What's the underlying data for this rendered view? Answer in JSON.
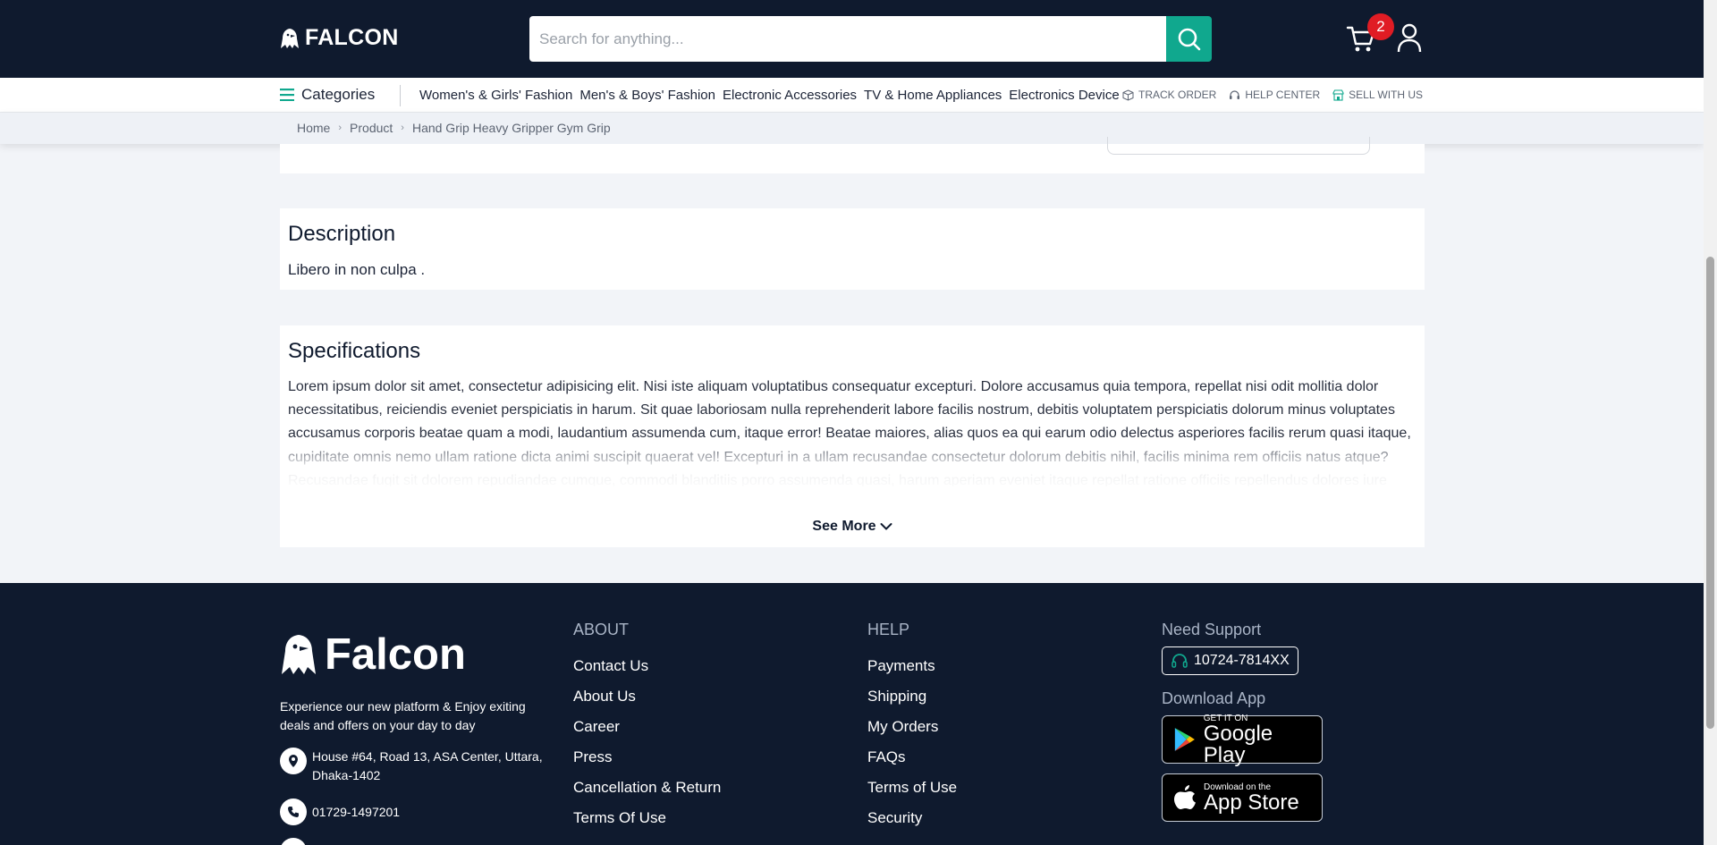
{
  "header": {
    "brand": "FALCON",
    "search_placeholder": "Search for anything...",
    "cart_count": "2",
    "accent_color": "#10a88e"
  },
  "nav": {
    "categories_label": "Categories",
    "links": [
      "Women's & Girls' Fashion",
      "Men's & Boys' Fashion",
      "Electronic Accessories",
      "TV & Home Appliances",
      "Electronics Device"
    ],
    "quick": [
      "TRACK ORDER",
      "HELP CENTER",
      "SELL WITH US"
    ]
  },
  "breadcrumb": [
    "Home",
    "Product",
    "Hand Grip Heavy Gripper Gym Grip"
  ],
  "description": {
    "title": "Description",
    "text": "Libero in non culpa ."
  },
  "specifications": {
    "title": "Specifications",
    "text": "Lorem ipsum dolor sit amet, consectetur adipisicing elit. Nisi iste aliquam voluptatibus consequatur excepturi. Dolore accusamus quia tempora, repellat nisi odit mollitia dolor necessitatibus, reiciendis eveniet perspiciatis in harum. Sit quae laboriosam nulla reprehenderit labore facilis nostrum, debitis voluptatem perspiciatis dolorum minus voluptates accusamus corporis beatae quam a modi, laudantium assumenda cum, itaque error! Beatae maiores, alias quos ea qui earum odio delectus asperiores facilis rerum quasi itaque, cupiditate omnis nemo ullam ratione dicta animi suscipit quaerat vel! Excepturi in a ullam recusandae consectetur dolorum debitis nihil, facilis minima rem officiis natus atque? Recusandae fugit sit dolorem repudiandae cumque, commodi blanditiis porro assumenda quasi, harum aperiam eveniet itaque repellat ratione officiis repellendus dolores iure expedita unde maiores autem minus? Corporis placeat, quo asperiores consequatur vitae inventore libero facere animi qui, tenetur",
    "see_more": "See More"
  },
  "footer": {
    "brand": "Falcon",
    "tagline": "Experience our new platform & Enjoy exiting deals and offers on your day to day",
    "address": "House #64, Road 13, ASA Center, Uttara, Dhaka-1402",
    "phone": "01729-1497201",
    "about": {
      "title": "ABOUT",
      "links": [
        "Contact Us",
        "About Us",
        "Career",
        "Press",
        "Cancellation & Return",
        "Terms Of Use"
      ]
    },
    "help": {
      "title": "HELP",
      "links": [
        "Payments",
        "Shipping",
        "My Orders",
        "FAQs",
        "Terms of Use",
        "Security"
      ]
    },
    "support": {
      "title": "Need Support",
      "number": "10724-7814XX"
    },
    "download": {
      "title": "Download App",
      "google_small": "GET IT ON",
      "google_big": "Google Play",
      "apple_small": "Download on the",
      "apple_big": "App Store"
    }
  }
}
